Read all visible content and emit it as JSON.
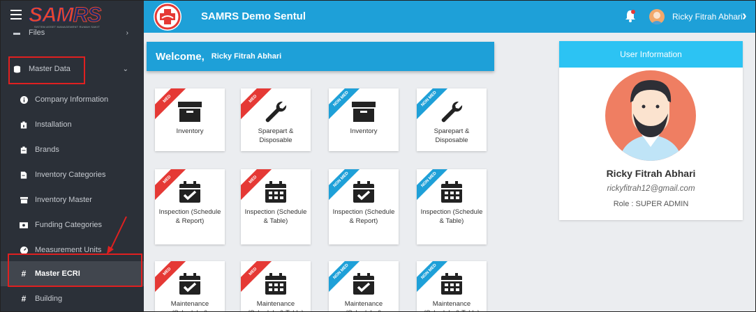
{
  "topbar": {
    "logo_main": "SAM",
    "logo_accent": "RS",
    "logo_tagline": "SISTEM ASSET MANAGEMENT RUMAH SAKIT",
    "app_title": "SAMRS Demo Sentul",
    "user_name": "Ricky Fitrah Abhari",
    "icons": [
      "hamburger-icon",
      "app-emblem-icon",
      "bell-icon",
      "user-avatar",
      "chevron-right-icon"
    ],
    "accent_color": "#1ea0d8"
  },
  "sidebar": {
    "files_label": "Files",
    "master_data_label": "Master Data",
    "items": [
      {
        "label": "Company Information",
        "icon": "info-icon"
      },
      {
        "label": "Installation",
        "icon": "installation-icon"
      },
      {
        "label": "Brands",
        "icon": "brand-icon"
      },
      {
        "label": "Inventory Categories",
        "icon": "file-icon"
      },
      {
        "label": "Inventory Master",
        "icon": "archive-icon"
      },
      {
        "label": "Funding Categories",
        "icon": "money-icon"
      },
      {
        "label": "Measurement Units",
        "icon": "gauge-icon"
      },
      {
        "label": "Master ECRI",
        "icon": "hash-icon"
      },
      {
        "label": "Building",
        "icon": "hash-icon"
      }
    ],
    "active_item": "Master ECRI",
    "highlight_color": "#e02020"
  },
  "welcome": {
    "greeting": "Welcome,",
    "name": "Ricky Fitrah Abhari"
  },
  "tiles": [
    {
      "badge": "MED",
      "badge_color": "red",
      "label": "Inventory",
      "icon": "archive-icon"
    },
    {
      "badge": "MED",
      "badge_color": "red",
      "label": "Sparepart & Disposable",
      "icon": "wrench-icon"
    },
    {
      "badge": "NON MED",
      "badge_color": "blue",
      "label": "Inventory",
      "icon": "archive-icon"
    },
    {
      "badge": "NON MED",
      "badge_color": "blue",
      "label": "Sparepart & Disposable",
      "icon": "wrench-icon"
    },
    {
      "badge": "MED",
      "badge_color": "red",
      "label": "Inspection (Schedule & Report)",
      "icon": "calendar-check-icon"
    },
    {
      "badge": "MED",
      "badge_color": "red",
      "label": "Inspection (Schedule & Table)",
      "icon": "calendar-grid-icon"
    },
    {
      "badge": "NON MED",
      "badge_color": "blue",
      "label": "Inspection (Schedule & Report)",
      "icon": "calendar-check-icon"
    },
    {
      "badge": "NON MED",
      "badge_color": "blue",
      "label": "Inspection (Schedule & Table)",
      "icon": "calendar-grid-icon"
    },
    {
      "badge": "MED",
      "badge_color": "red",
      "label": "Maintenance (Schedule &",
      "icon": "calendar-check-icon"
    },
    {
      "badge": "MED",
      "badge_color": "red",
      "label": "Maintenance (Schedule & Table)",
      "icon": "calendar-grid-icon"
    },
    {
      "badge": "NON MED",
      "badge_color": "blue",
      "label": "Maintenance (Schedule &",
      "icon": "calendar-check-icon"
    },
    {
      "badge": "NON MED",
      "badge_color": "blue",
      "label": "Maintenance (Schedule & Table)",
      "icon": "calendar-grid-icon"
    }
  ],
  "user_info": {
    "header": "User Information",
    "name": "Ricky Fitrah Abhari",
    "email": "rickyfitrah12@gmail.com",
    "role": "Role : SUPER ADMIN"
  }
}
